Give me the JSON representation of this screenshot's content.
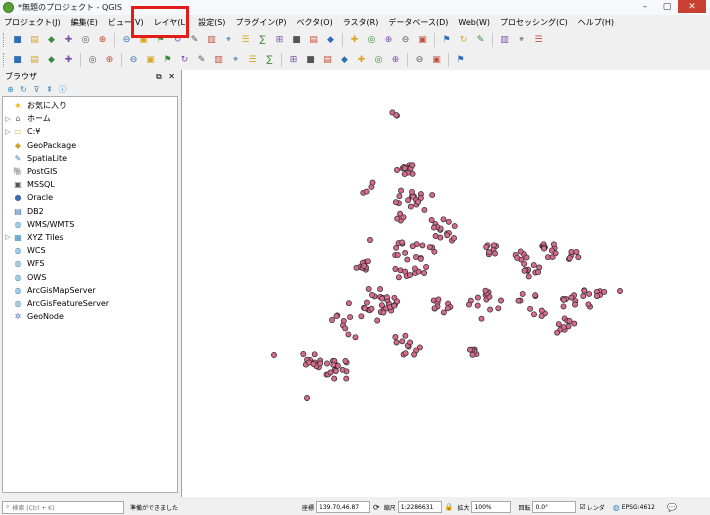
{
  "window": {
    "title": "*無題のプロジェクト - QGIS",
    "minimize": "–",
    "maximize": "▢",
    "close": "✕"
  },
  "menu": [
    "プロジェクト(J)",
    "編集(E)",
    "ビュー(V)",
    "レイヤ(L)",
    "設定(S)",
    "プラグイン(P)",
    "ベクタ(O)",
    "ラスタ(R)",
    "データベース(D)",
    "Web(W)",
    "プロセッシング(C)",
    "ヘルプ(H)"
  ],
  "toolbar1_icons": [
    "new-project-icon",
    "open-project-icon",
    "save-project-icon",
    "save-as-icon",
    "new-print-layout-icon",
    "layout-manager-icon",
    "pan-icon",
    "pan-to-selection-icon",
    "zoom-in-icon",
    "zoom-out-icon",
    "zoom-native-icon",
    "zoom-full-icon",
    "zoom-to-selection-icon",
    "zoom-to-layer-icon",
    "zoom-last-icon",
    "zoom-next-icon",
    "new-bookmark-icon",
    "show-bookmarks-icon",
    "refresh-icon",
    "identify-icon",
    "measure-icon",
    "select-icon",
    "deselect-icon",
    "attribute-table-icon",
    "field-calculator-icon",
    "processing-toolbox-icon",
    "statistics-icon",
    "measure-line-icon",
    "annotation-icon",
    "text-annotation-icon"
  ],
  "toolbar2_icons": [
    "data-source-manager-icon",
    "new-layer-icon",
    "add-vector-icon",
    "add-raster-icon",
    "digitize-icon",
    "edit-pencil-icon",
    "save-edits-icon",
    "add-feature-icon",
    "vertex-tool-icon",
    "delete-icon",
    "cut-icon",
    "copy-icon",
    "paste-icon",
    "undo-icon",
    "redo-icon",
    "label-icon",
    "label-pin-icon",
    "label-highlight-icon",
    "label-move-icon",
    "label-rotate-icon",
    "label-change-icon",
    "label-show-icon",
    "georeferencer-icon",
    "python-icon",
    "help-icon"
  ],
  "browser": {
    "title": "ブラウザ",
    "items": [
      {
        "label": "お気に入り",
        "icon": "star-icon",
        "expand": false,
        "color": "#e8b800",
        "glyph": "★"
      },
      {
        "label": "ホーム",
        "icon": "home-icon",
        "expand": true,
        "color": "#666",
        "glyph": "⌂"
      },
      {
        "label": "C:¥",
        "icon": "folder-icon",
        "expand": true,
        "color": "#d9b44a",
        "glyph": "▭"
      },
      {
        "label": "GeoPackage",
        "icon": "geopackage-icon",
        "expand": false,
        "color": "#c9a227",
        "glyph": "◆"
      },
      {
        "label": "SpatiaLite",
        "icon": "spatialite-icon",
        "expand": false,
        "color": "#3b77bc",
        "glyph": "✎"
      },
      {
        "label": "PostGIS",
        "icon": "postgis-icon",
        "expand": false,
        "color": "#336791",
        "glyph": "🐘"
      },
      {
        "label": "MSSQL",
        "icon": "mssql-icon",
        "expand": false,
        "color": "#555",
        "glyph": "▣"
      },
      {
        "label": "Oracle",
        "icon": "oracle-icon",
        "expand": false,
        "color": "#3a6ab0",
        "glyph": "●"
      },
      {
        "label": "DB2",
        "icon": "db2-icon",
        "expand": false,
        "color": "#3a6ab0",
        "glyph": "▤"
      },
      {
        "label": "WMS/WMTS",
        "icon": "wms-icon",
        "expand": false,
        "color": "#3a8ac0",
        "glyph": "◍"
      },
      {
        "label": "XYZ Tiles",
        "icon": "xyz-tiles-icon",
        "expand": true,
        "color": "#3a8ac0",
        "glyph": "▦"
      },
      {
        "label": "WCS",
        "icon": "wcs-icon",
        "expand": false,
        "color": "#3a8ac0",
        "glyph": "◍"
      },
      {
        "label": "WFS",
        "icon": "wfs-icon",
        "expand": false,
        "color": "#3a8ac0",
        "glyph": "◍"
      },
      {
        "label": "OWS",
        "icon": "ows-icon",
        "expand": false,
        "color": "#3a8ac0",
        "glyph": "◍"
      },
      {
        "label": "ArcGisMapServer",
        "icon": "arcgis-map-icon",
        "expand": false,
        "color": "#3a8ac0",
        "glyph": "◍"
      },
      {
        "label": "ArcGisFeatureServer",
        "icon": "arcgis-feature-icon",
        "expand": false,
        "color": "#3a8ac0",
        "glyph": "◍"
      },
      {
        "label": "GeoNode",
        "icon": "geonode-icon",
        "expand": false,
        "color": "#4a7ab0",
        "glyph": "✲"
      }
    ]
  },
  "status": {
    "search_placeholder": "検索 (Ctrl + K)",
    "message": "準備ができました",
    "coord_label": "座標",
    "coord_value": "139.70,46.87",
    "scale_label": "縮尺",
    "scale_value": "1:2286631",
    "magnifier_label": "拡大",
    "magnifier_value": "100%",
    "rotation_label": "回転",
    "rotation_value": "0.0°",
    "render_label": "レンダ",
    "crs": "EPSG:4612"
  },
  "colors": {
    "point_fill": "#d66a8a",
    "point_stroke": "#2a2a2a",
    "highlight": "#e31b1b"
  }
}
